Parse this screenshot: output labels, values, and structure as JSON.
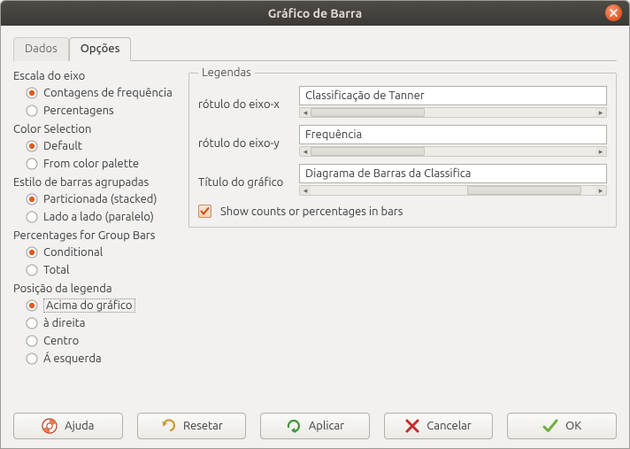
{
  "window": {
    "title": "Gráfico de Barra"
  },
  "tabs": {
    "data": "Dados",
    "options": "Opções",
    "active": "options"
  },
  "left": {
    "axis_scale": {
      "label": "Escala do eixo",
      "freq": "Contagens de frequência",
      "pct": "Percentagens"
    },
    "color": {
      "label": "Color Selection",
      "default": "Default",
      "palette": "From color palette"
    },
    "style": {
      "label": "Estilo de barras agrupadas",
      "stacked": "Particionada (stacked)",
      "side": "Lado a lado (paralelo)"
    },
    "pct_group": {
      "label": "Percentages for Group Bars",
      "cond": "Conditional",
      "total": "Total"
    },
    "legend_pos": {
      "label": "Posição da legenda",
      "top": "Acima do gráfico",
      "right": "à direita",
      "center": "Centro",
      "left": "Á esquerda"
    }
  },
  "legends": {
    "title": "Legendas",
    "xlabel": "rótulo do eixo-x",
    "xvalue": "Classificação de Tanner",
    "ylabel": "rótulo do eixo-y",
    "yvalue": "Frequência",
    "chart_title_label": "Título do gráfico",
    "chart_title_value": "Diagrama de Barras da Classifica",
    "show_counts": "Show counts or percentages in bars"
  },
  "buttons": {
    "help": "Ajuda",
    "reset": "Resetar",
    "apply": "Aplicar",
    "cancel": "Cancelar",
    "ok": "OK"
  }
}
